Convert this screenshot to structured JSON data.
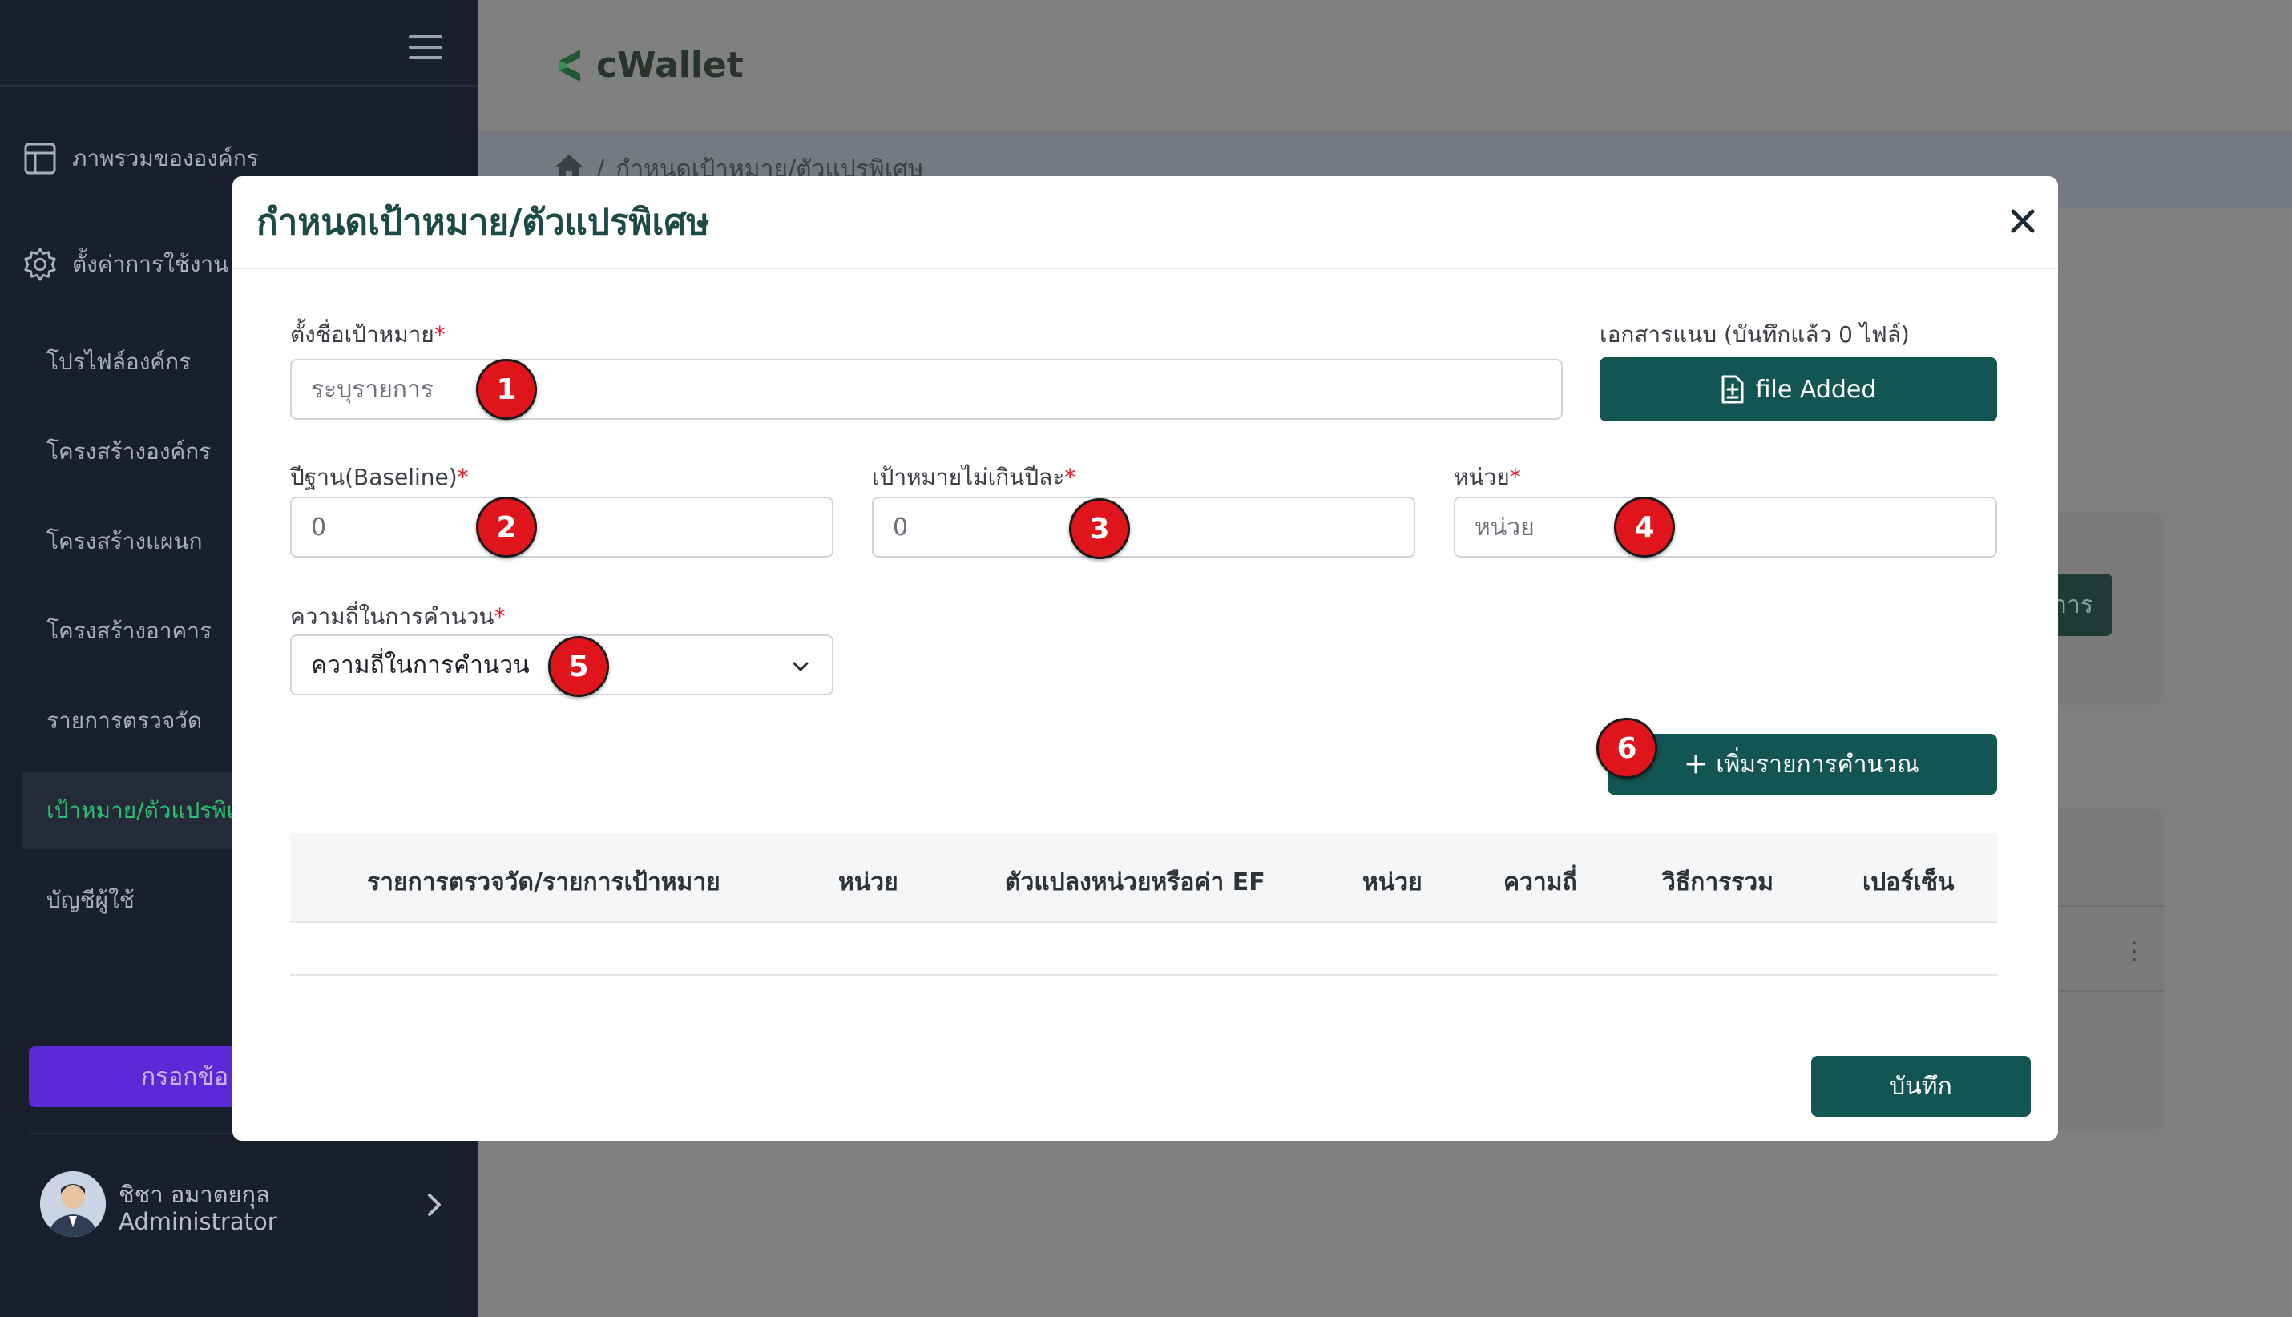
{
  "app": {
    "logo_text": "cWallet"
  },
  "breadcrumb": {
    "current": "กำหนดเป้าหมาย/ตัวแปรพิเศษ"
  },
  "sidebar": {
    "main_items": [
      {
        "label": "ภาพรวมขององค์กร",
        "icon": "layout-icon"
      },
      {
        "label": "ตั้งค่าการใช้งาน",
        "icon": "gear-icon"
      }
    ],
    "sub_items": [
      {
        "label": "โปรไฟล์องค์กร"
      },
      {
        "label": "โครงสร้างองค์กร"
      },
      {
        "label": "โครงสร้างแผนก"
      },
      {
        "label": "โครงสร้างอาคาร"
      },
      {
        "label": "รายการตรวจวัด"
      },
      {
        "label": "เป้าหมาย/ตัวแปรพิเศษ",
        "active": true
      },
      {
        "label": "บัญชีผู้ใช้"
      }
    ],
    "cta_label": "กรอกข้อ",
    "user": {
      "name": "ชิชา อมาตยกุล",
      "role": "Administrator"
    }
  },
  "background": {
    "button_label": "าาร"
  },
  "modal": {
    "title": "กำหนดเป้าหมาย/ตัวแปรพิเศษ",
    "name_field": {
      "label": "ตั้งชื่อเป้าหมาย",
      "placeholder": "ระบุรายการ"
    },
    "attachments": {
      "label": "เอกสารแนบ (บันทึกแล้ว 0 ไฟล์)",
      "button_label": "file Added"
    },
    "baseline": {
      "label": "ปีฐาน(Baseline)",
      "value": "0"
    },
    "target": {
      "label": "เป้าหมายไม่เกินปีละ",
      "value": "0"
    },
    "unit": {
      "label": "หน่วย",
      "placeholder": "หน่วย"
    },
    "frequency": {
      "label": "ความถี่ในการคำนวน",
      "selected": "ความถี่ในการคำนวน"
    },
    "add_button_label": "เพิ่มรายการคำนวณ",
    "table_headers": [
      "รายการตรวจวัด/รายการเป้าหมาย",
      "หน่วย",
      "ตัวแปลงหน่วยหรือค่า EF",
      "หน่วย",
      "ความถี่",
      "วิธีการรวม",
      "เปอร์เซ็น"
    ],
    "save_label": "บันทึก",
    "required_mark": "*"
  },
  "badges": [
    "1",
    "2",
    "3",
    "4",
    "5",
    "6"
  ],
  "colors": {
    "brand": "#125552",
    "sidebar": "#1a1f2e",
    "active_text": "#2fbf71",
    "required": "#e0202b",
    "badge": "#e0141b"
  }
}
